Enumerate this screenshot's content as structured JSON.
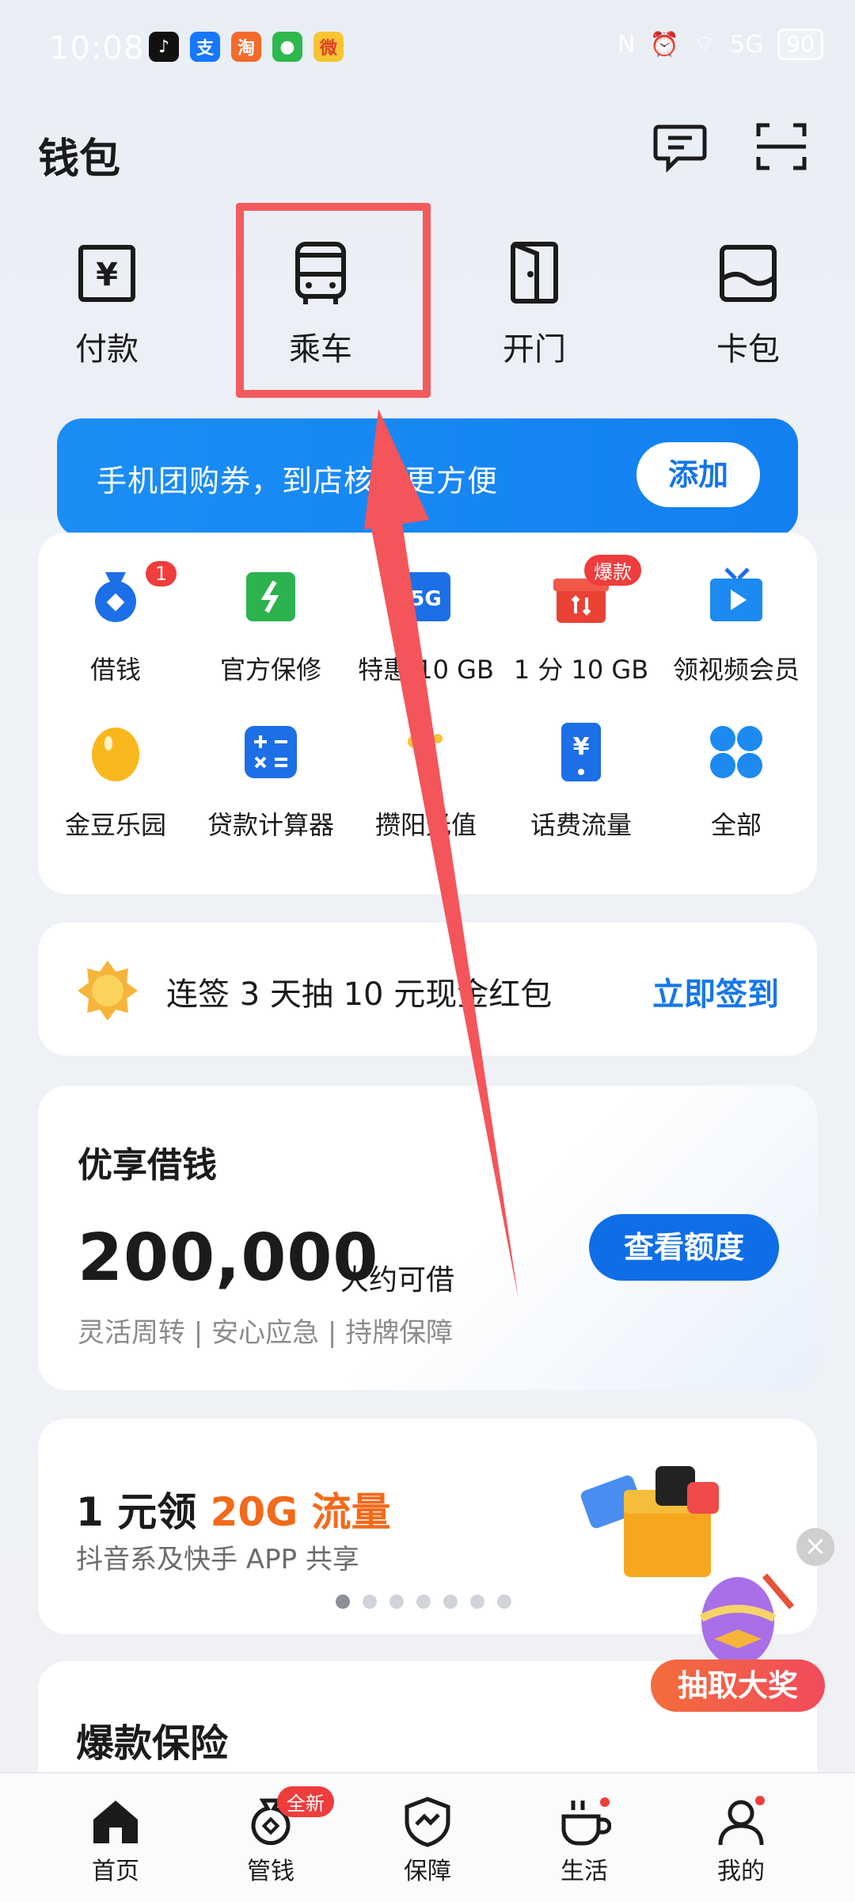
{
  "status_bar": {
    "time": "10:08",
    "network": "5G",
    "battery": "90"
  },
  "header": {
    "title": "钱包",
    "message_icon": "message-icon",
    "scan_icon": "scan-icon"
  },
  "quick_actions": [
    {
      "label": "付款",
      "icon": "payment-icon"
    },
    {
      "label": "乘车",
      "icon": "bus-icon"
    },
    {
      "label": "开门",
      "icon": "door-icon"
    },
    {
      "label": "卡包",
      "icon": "card-wallet-icon"
    }
  ],
  "banner": {
    "text": "手机团购券，到店核销更方便",
    "button": "添加"
  },
  "services": [
    {
      "label": "借钱",
      "icon": "money-bag-icon",
      "badge": "1"
    },
    {
      "label": "官方保修",
      "icon": "repair-icon"
    },
    {
      "label": "特惠 10 GB",
      "icon": "5g-icon",
      "icon_text": "5G"
    },
    {
      "label": "1 分 10 GB",
      "icon": "gift-icon",
      "badge": "爆款"
    },
    {
      "label": "领视频会员",
      "icon": "tv-icon"
    },
    {
      "label": "金豆乐园",
      "icon": "bean-icon"
    },
    {
      "label": "贷款计算器",
      "icon": "calculator-icon"
    },
    {
      "label": "攒阳光值",
      "icon": "sunshine-icon"
    },
    {
      "label": "话费流量",
      "icon": "phone-bill-icon"
    },
    {
      "label": "全部",
      "icon": "all-apps-icon"
    }
  ],
  "sign_in": {
    "text": "连签 3 天抽 10 元现金红包",
    "action": "立即签到"
  },
  "loan": {
    "title": "优享借钱",
    "amount": "200,000",
    "unit": "大约可借",
    "subtitle": "灵活周转 | 安心应急 | 持牌保障",
    "button": "查看额度"
  },
  "promo": {
    "title_prefix": "1 元领 ",
    "title_highlight": "20G 流量",
    "subtitle": "抖音系及快手 APP 共享",
    "pages": 7,
    "active_page": 1
  },
  "insurance": {
    "title": "爆款保险"
  },
  "floating": {
    "label": "抽取大奖"
  },
  "bottom_tabs": [
    {
      "label": "首页",
      "icon": "home-icon"
    },
    {
      "label": "管钱",
      "icon": "money-manage-icon",
      "badge": "全新"
    },
    {
      "label": "保障",
      "icon": "shield-icon"
    },
    {
      "label": "生活",
      "icon": "coffee-icon"
    },
    {
      "label": "我的",
      "icon": "profile-icon"
    }
  ],
  "colors": {
    "accent": "#1677e9",
    "highlight": "#f45b5e",
    "promo": "#f26a1b"
  }
}
